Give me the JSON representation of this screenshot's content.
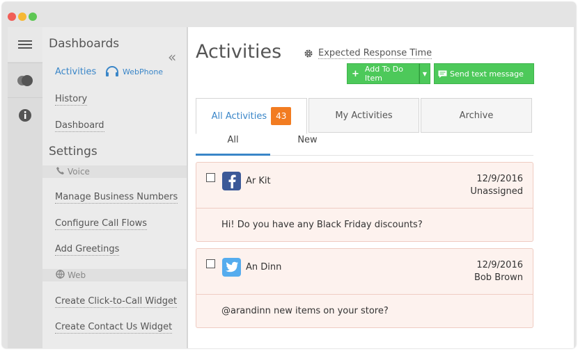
{
  "window": {
    "controls": [
      "close",
      "minimize",
      "maximize"
    ]
  },
  "iconbar": {
    "items": [
      {
        "name": "hamburger-icon"
      },
      {
        "name": "toggle-icon"
      },
      {
        "name": "info-icon"
      }
    ]
  },
  "sidebar": {
    "dashboards_heading": "Dashboards",
    "collapse": "«",
    "activities": "Activities",
    "webphone": "WebPhone",
    "history": "History",
    "dashboard": "Dashboard",
    "settings_heading": "Settings",
    "voice_section": "Voice",
    "manage_numbers": "Manage Business Numbers",
    "call_flows": "Configure Call Flows",
    "greetings": "Add Greetings",
    "web_section": "Web",
    "click_to_call": "Create Click-to-Call Widget",
    "contact_us": "Create Contact Us Widget"
  },
  "main": {
    "title": "Activities",
    "expected_response": "Expected Response Time",
    "add_todo": "Add To Do Item",
    "send_text": "Send text message",
    "tabs": [
      {
        "label": "All Activities",
        "badge": "43"
      },
      {
        "label": "My Activities"
      },
      {
        "label": "Archive"
      }
    ],
    "subtabs": [
      {
        "label": "All"
      },
      {
        "label": "New"
      }
    ],
    "activities": [
      {
        "source": "facebook",
        "name": "Ar Kit",
        "date": "12/9/2016",
        "assignee": "Unassigned",
        "message": "Hi! Do you have any Black Friday discounts?"
      },
      {
        "source": "twitter",
        "name": "An Dinn",
        "date": "12/9/2016",
        "assignee": "Bob Brown",
        "message": "@arandinn new items on your store?"
      }
    ]
  },
  "colors": {
    "accent": "#3a86c8",
    "green": "#4dc95a",
    "badge": "#f27c21",
    "card_bg": "#fdf2ee",
    "facebook": "#3b5998",
    "twitter": "#55acee"
  }
}
